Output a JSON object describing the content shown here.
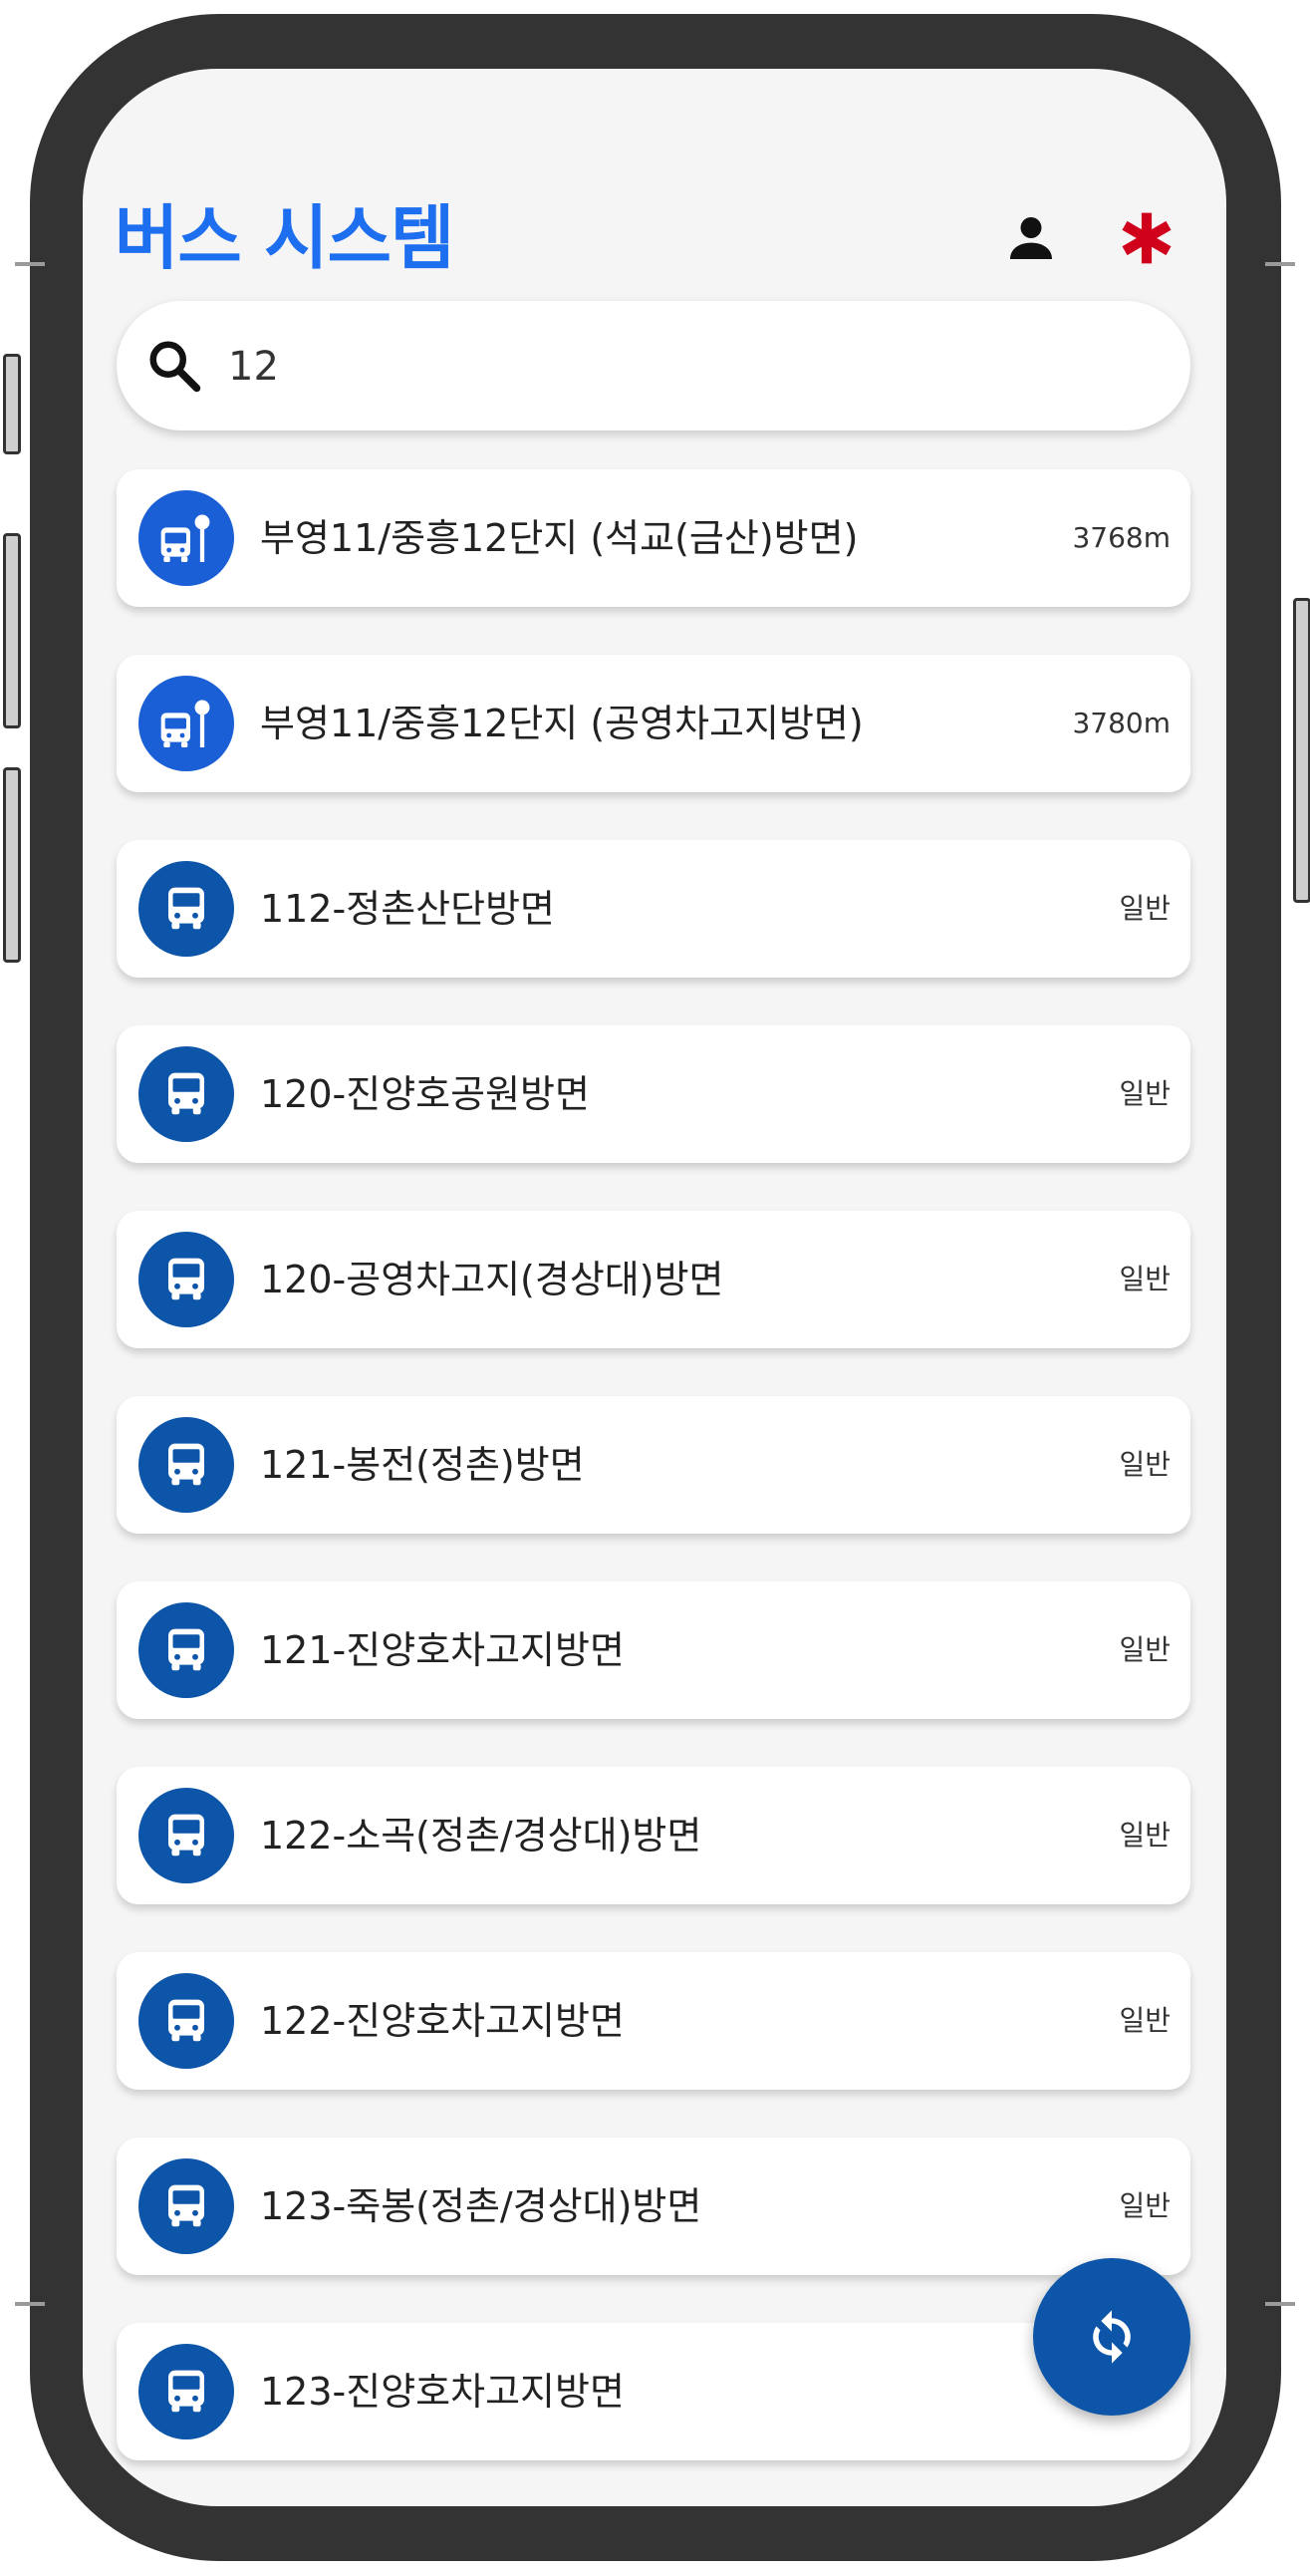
{
  "header": {
    "title": "버스 시스템",
    "profile_icon": "person-icon",
    "settings_icon": "asterisk-icon",
    "accent_color": "#1e6ef0",
    "settings_color": "#d0021b"
  },
  "search": {
    "value": "12",
    "icon": "search-icon"
  },
  "results": [
    {
      "kind": "stop",
      "icon": "bus-stop-icon",
      "name": "부영11/중흥12단지 (석교(금산)방면)",
      "meta": "3768m"
    },
    {
      "kind": "stop",
      "icon": "bus-stop-icon",
      "name": "부영11/중흥12단지 (공영차고지방면)",
      "meta": "3780m"
    },
    {
      "kind": "route",
      "icon": "bus-icon",
      "name": "112-정촌산단방면",
      "meta": "일반"
    },
    {
      "kind": "route",
      "icon": "bus-icon",
      "name": "120-진양호공원방면",
      "meta": "일반"
    },
    {
      "kind": "route",
      "icon": "bus-icon",
      "name": "120-공영차고지(경상대)방면",
      "meta": "일반"
    },
    {
      "kind": "route",
      "icon": "bus-icon",
      "name": "121-봉전(정촌)방면",
      "meta": "일반"
    },
    {
      "kind": "route",
      "icon": "bus-icon",
      "name": "121-진양호차고지방면",
      "meta": "일반"
    },
    {
      "kind": "route",
      "icon": "bus-icon",
      "name": "122-소곡(정촌/경상대)방면",
      "meta": "일반"
    },
    {
      "kind": "route",
      "icon": "bus-icon",
      "name": "122-진양호차고지방면",
      "meta": "일반"
    },
    {
      "kind": "route",
      "icon": "bus-icon",
      "name": "123-죽봉(정촌/경상대)방면",
      "meta": "일반"
    },
    {
      "kind": "route",
      "icon": "bus-icon",
      "name": "123-진양호차고지방면",
      "meta": ""
    }
  ],
  "fab": {
    "icon": "refresh-icon",
    "color": "#0d55a8"
  }
}
